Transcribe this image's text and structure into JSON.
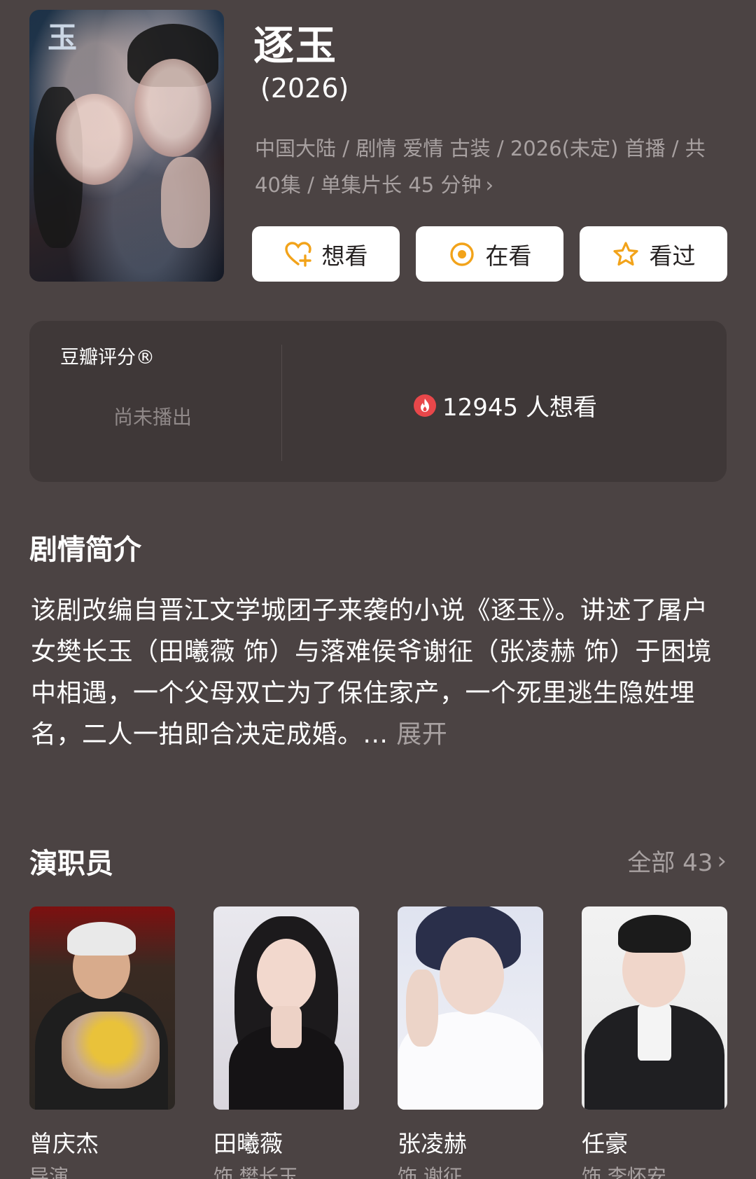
{
  "show": {
    "title": "逐玉",
    "year": "(2026)",
    "meta": "中国大陆 / 剧情 爱情 古装 / 2026(未定) 首播 / 共 40集 / 单集片长 45 分钟",
    "meta_chevron": "›",
    "poster_glyph": "玉"
  },
  "actions": [
    {
      "label": "想看",
      "icon": "heart-plus-icon"
    },
    {
      "label": "在看",
      "icon": "target-icon"
    },
    {
      "label": "看过",
      "icon": "star-icon"
    }
  ],
  "rating": {
    "label": "豆瓣评分®",
    "status": "尚未播出",
    "wish_text": "12945 人想看",
    "wish_icon": "fire-icon"
  },
  "synopsis": {
    "heading": "剧情简介",
    "text": "该剧改编自晋江文学城团子来袭的小说《逐玉》。讲述了屠户女樊长玉（田曦薇 饰）与落难侯爷谢征（张凌赫 饰）于困境中相遇，一个父母双亡为了保住家产，一个死里逃生隐姓埋名，二人一拍即合决定成婚。...",
    "more": "展开"
  },
  "cast": {
    "heading": "演职员",
    "all_label": "全部 43",
    "all_chevron": "›",
    "members": [
      {
        "name": "曾庆杰",
        "role": "导演"
      },
      {
        "name": "田曦薇",
        "role": "饰 樊长玉"
      },
      {
        "name": "张凌赫",
        "role": "饰 谢征"
      },
      {
        "name": "任豪",
        "role": "饰 李怀安"
      }
    ]
  },
  "colors": {
    "background": "#4b4343",
    "card": "#3f3838",
    "accent_orange": "#f2a31a",
    "fire_red": "#e8474a",
    "muted_text": "#a8a1a1"
  }
}
